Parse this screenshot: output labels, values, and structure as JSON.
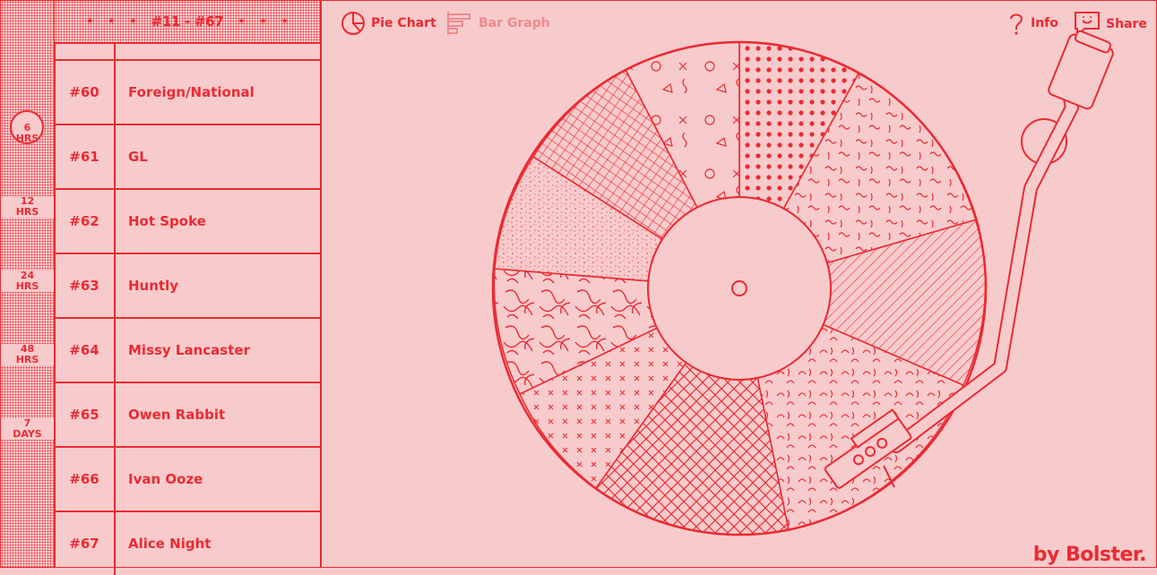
{
  "rail": {
    "items": [
      {
        "value": "6",
        "unit": "HRS",
        "active": true
      },
      {
        "value": "12",
        "unit": "HRS",
        "active": false
      },
      {
        "value": "24",
        "unit": "HRS",
        "active": false
      },
      {
        "value": "48",
        "unit": "HRS",
        "active": false
      },
      {
        "value": "7",
        "unit": "DAYS",
        "active": false
      }
    ]
  },
  "list": {
    "range_label": "#11 - #67",
    "star": "★",
    "rows": [
      {
        "rank": "#60",
        "name": "Foreign/National"
      },
      {
        "rank": "#61",
        "name": "GL"
      },
      {
        "rank": "#62",
        "name": "Hot Spoke"
      },
      {
        "rank": "#63",
        "name": "Huntly"
      },
      {
        "rank": "#64",
        "name": "Missy Lancaster"
      },
      {
        "rank": "#65",
        "name": "Owen Rabbit"
      },
      {
        "rank": "#66",
        "name": "Ivan Ooze"
      },
      {
        "rank": "#67",
        "name": "Alice Night"
      }
    ]
  },
  "toolbar": {
    "pie_label": "Pie Chart",
    "bar_label": "Bar Graph",
    "info_label": "Info",
    "share_label": "Share"
  },
  "brand": "by Bolster.",
  "colors": {
    "accent": "#ec2a32",
    "background": "#f7cbcc",
    "dim": "#ee8a8e"
  }
}
